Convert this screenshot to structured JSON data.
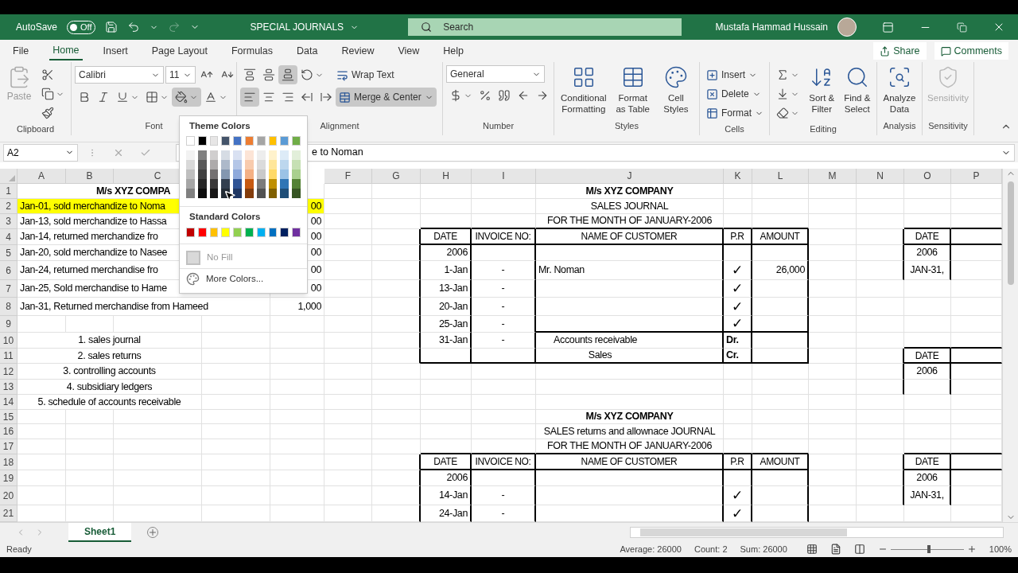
{
  "title_bar": {
    "autosave_label": "AutoSave",
    "autosave": {
      "on": false,
      "label": "Off"
    },
    "document": "SPECIAL JOURNALS",
    "search": {
      "placeholder": "Search"
    },
    "user": "Mustafa Hammad Hussain"
  },
  "menu_tabs": [
    {
      "label": "File",
      "selected": false
    },
    {
      "label": "Home",
      "selected": true
    },
    {
      "label": "Insert",
      "selected": false
    },
    {
      "label": "Page Layout",
      "selected": false
    },
    {
      "label": "Formulas",
      "selected": false
    },
    {
      "label": "Data",
      "selected": false
    },
    {
      "label": "Review",
      "selected": false
    },
    {
      "label": "View",
      "selected": false
    },
    {
      "label": "Help",
      "selected": false
    }
  ],
  "share": "Share",
  "comments": "Comments",
  "ribbon": {
    "clipboard": {
      "label": "Clipboard",
      "paste": "Paste"
    },
    "font": {
      "label": "Font",
      "font_name": "Calibri",
      "font_size": "11",
      "fill_menu_open": true
    },
    "alignment": {
      "label": "Alignment",
      "wrap_text": "Wrap Text",
      "merge": "Merge & Center"
    },
    "number": {
      "label": "Number",
      "format": "General"
    },
    "styles": {
      "label": "Styles",
      "buttons": [
        "Conditional Formatting",
        "Format as Table",
        "Cell Styles"
      ]
    },
    "cells": {
      "label": "Cells",
      "buttons": [
        "Insert",
        "Delete",
        "Format"
      ]
    },
    "editing": {
      "label": "Editing",
      "buttons": [
        "Sort & Filter",
        "Find & Select"
      ]
    },
    "analysis": {
      "label": "Analysis",
      "button": "Analyze Data"
    },
    "sensitivity": {
      "label": "Sensitivity",
      "button": "Sensitivity",
      "disabled": true
    }
  },
  "fill_menu": {
    "theme_title": "Theme Colors",
    "theme": [
      {
        "color": "#ffffff"
      },
      {
        "color": "#000000"
      },
      {
        "color": "#e7e6e6"
      },
      {
        "color": "#44546a"
      },
      {
        "color": "#4472c4"
      },
      {
        "color": "#ed7d31"
      },
      {
        "color": "#a5a5a5"
      },
      {
        "color": "#ffc000"
      },
      {
        "color": "#5b9bd5"
      },
      {
        "color": "#70ad47"
      }
    ],
    "shades": [
      [
        {
          "color": "#f2f2f2"
        },
        {
          "color": "#808080"
        },
        {
          "color": "#d0cece"
        },
        {
          "color": "#d6dce4"
        },
        {
          "color": "#d9e1f2"
        },
        {
          "color": "#fce4d6"
        },
        {
          "color": "#ededed"
        },
        {
          "color": "#fff2cc"
        },
        {
          "color": "#ddebf7"
        },
        {
          "color": "#e2efda"
        }
      ],
      [
        {
          "color": "#d9d9d9"
        },
        {
          "color": "#595959"
        },
        {
          "color": "#aeabab"
        },
        {
          "color": "#adb9ca"
        },
        {
          "color": "#b4c6e7"
        },
        {
          "color": "#f8cbad"
        },
        {
          "color": "#dbdbdb"
        },
        {
          "color": "#ffe699"
        },
        {
          "color": "#bdd7ee"
        },
        {
          "color": "#c6e0b4"
        }
      ],
      [
        {
          "color": "#bfbfbf"
        },
        {
          "color": "#404040"
        },
        {
          "color": "#757171"
        },
        {
          "color": "#8497b0"
        },
        {
          "color": "#8ea9db"
        },
        {
          "color": "#f4b084"
        },
        {
          "color": "#c9c9c9"
        },
        {
          "color": "#ffd966"
        },
        {
          "color": "#9bc2e6"
        },
        {
          "color": "#a9d08e"
        }
      ],
      [
        {
          "color": "#a6a6a6"
        },
        {
          "color": "#262626"
        },
        {
          "color": "#3a3838"
        },
        {
          "color": "#333f4f"
        },
        {
          "color": "#305496"
        },
        {
          "color": "#c65911"
        },
        {
          "color": "#7b7b7b"
        },
        {
          "color": "#bf8f00"
        },
        {
          "color": "#2f75b5"
        },
        {
          "color": "#548235"
        }
      ],
      [
        {
          "color": "#808080"
        },
        {
          "color": "#0d0d0d"
        },
        {
          "color": "#171616"
        },
        {
          "color": "#222b35"
        },
        {
          "color": "#203764"
        },
        {
          "color": "#833c0c"
        },
        {
          "color": "#525252"
        },
        {
          "color": "#806000"
        },
        {
          "color": "#1f4e78"
        },
        {
          "color": "#375623"
        }
      ]
    ],
    "standard_title": "Standard Colors",
    "standard": [
      {
        "color": "#c00000"
      },
      {
        "color": "#ff0000"
      },
      {
        "color": "#ffc000"
      },
      {
        "color": "#ffff00"
      },
      {
        "color": "#92d050"
      },
      {
        "color": "#00b050"
      },
      {
        "color": "#00b0f0"
      },
      {
        "color": "#0070c0"
      },
      {
        "color": "#002060"
      },
      {
        "color": "#7030a0"
      }
    ],
    "no_fill": "No Fill",
    "more_colors": "More Colors..."
  },
  "formula_bar": {
    "name_box": "A2",
    "content": "e to Noman"
  },
  "sheet": {
    "columns": [
      "A",
      "B",
      "C",
      null,
      null,
      "F",
      "G",
      "H",
      "I",
      "J",
      "K",
      "L",
      "M",
      "N",
      "O",
      "P"
    ],
    "rows": [
      {
        "number": "1",
        "cells": [
          {
            "kind": "cut-title",
            "text": "M/s XYZ  COMPA"
          },
          "",
          "",
          "",
          "",
          "",
          "",
          "",
          "",
          {
            "kind": "title",
            "text": "M/s XYZ COMPANY"
          }
        ]
      },
      {
        "number": "2",
        "cells": [
          {
            "kind": "text",
            "text": "Jan-01, sold merchandize to Noma",
            "color": "#ffff00"
          },
          "",
          "",
          "",
          {
            "kind": "num",
            "text": "00",
            "color": "#ffff00"
          },
          "",
          "",
          "",
          "",
          {
            "kind": "center",
            "text": "SALES JOURNAL"
          }
        ]
      },
      {
        "number": "3",
        "cells": [
          {
            "kind": "text",
            "text": "Jan-13, sold merchandize to Hassa"
          },
          "",
          "",
          "",
          {
            "kind": "num",
            "text": "00"
          },
          "",
          "",
          "",
          "",
          {
            "kind": "center",
            "text": "FOR THE MONTH OF JANUARY-2006"
          }
        ]
      },
      {
        "number": "4",
        "cells": [
          {
            "kind": "text",
            "text": "Jan-14, returned merchandize fro"
          },
          "",
          "",
          "",
          {
            "kind": "num",
            "text": "00"
          },
          "",
          "",
          {
            "kind": "header",
            "text": "DATE"
          },
          {
            "kind": "header",
            "text": "INVOICE NO:"
          },
          {
            "kind": "header",
            "text": "NAME OF CUSTOMER"
          },
          {
            "kind": "header",
            "text": "P.R"
          },
          {
            "kind": "header",
            "text": "AMOUNT"
          },
          "",
          "",
          {
            "kind": "header",
            "text": "DATE"
          }
        ]
      },
      {
        "number": "5",
        "cells": [
          {
            "kind": "text",
            "text": "Jan-20, sold merchandize to Nasee"
          },
          "",
          "",
          "",
          {
            "kind": "num",
            "text": "00"
          },
          "",
          "",
          {
            "kind": "num",
            "text": "2006"
          },
          "",
          "",
          "",
          "",
          "",
          "",
          {
            "kind": "center",
            "text": "2006"
          }
        ]
      },
      {
        "number": "6",
        "cells": [
          {
            "kind": "text",
            "text": "Jan-24, returned merchandise fro"
          },
          "",
          "",
          "",
          {
            "kind": "num",
            "text": "00"
          },
          "",
          "",
          {
            "kind": "num",
            "text": "1-Jan"
          },
          {
            "kind": "center",
            "text": "-"
          },
          {
            "kind": "text",
            "text": "Mr. Noman"
          },
          {
            "kind": "check",
            "text": "✓"
          },
          {
            "kind": "num",
            "text": "26,000"
          },
          "",
          "",
          {
            "kind": "center",
            "text": "JAN-31,"
          }
        ]
      },
      {
        "number": "7",
        "cells": [
          {
            "kind": "text",
            "text": "Jan-25, Sold merchandise to Hame"
          },
          "",
          "",
          "",
          {
            "kind": "num",
            "text": "00"
          },
          "",
          "",
          {
            "kind": "num",
            "text": "13-Jan"
          },
          {
            "kind": "center",
            "text": "-"
          },
          "",
          {
            "kind": "check",
            "text": "✓"
          }
        ]
      },
      {
        "number": "8",
        "cells": [
          {
            "kind": "text",
            "text": "Jan-31, Returned merchandise from Hameed"
          },
          "",
          "",
          "",
          {
            "kind": "num",
            "text": "1,000"
          },
          "",
          "",
          {
            "kind": "num",
            "text": "20-Jan"
          },
          {
            "kind": "center",
            "text": "-"
          },
          "",
          {
            "kind": "check",
            "text": "✓"
          }
        ]
      },
      {
        "number": "9",
        "cells": [
          "",
          "",
          "",
          "",
          "",
          "",
          "",
          {
            "kind": "num",
            "text": "25-Jan"
          },
          {
            "kind": "center",
            "text": "-"
          },
          "",
          {
            "kind": "check",
            "text": "✓"
          }
        ]
      },
      {
        "number": "10",
        "cells": [
          {
            "kind": "merged-center",
            "text": "1. sales journal"
          },
          "",
          "",
          "",
          "",
          "",
          "",
          {
            "kind": "num",
            "text": "31-Jan"
          },
          {
            "kind": "center",
            "text": "-"
          },
          {
            "kind": "indent",
            "text": "Accounts receivable"
          },
          {
            "kind": "label",
            "text": "Dr."
          }
        ]
      },
      {
        "number": "11",
        "cells": [
          {
            "kind": "merged-center",
            "text": "2. sales returns"
          },
          "",
          "",
          "",
          "",
          "",
          "",
          "",
          "",
          {
            "kind": "indent-center",
            "text": "Sales"
          },
          {
            "kind": "label",
            "text": "Cr."
          },
          "",
          "",
          "",
          {
            "kind": "header",
            "text": "DATE"
          }
        ]
      },
      {
        "number": "12",
        "cells": [
          {
            "kind": "merged-center",
            "text": "3. controlling accounts"
          },
          "",
          "",
          "",
          "",
          "",
          "",
          "",
          "",
          "",
          "",
          "",
          "",
          "",
          {
            "kind": "center",
            "text": "2006"
          }
        ]
      },
      {
        "number": "13",
        "cells": [
          {
            "kind": "merged-center",
            "text": "4. subsidiary ledgers"
          }
        ]
      },
      {
        "number": "14",
        "cells": [
          {
            "kind": "merged-center",
            "text": "5. schedule of accounts receivable"
          }
        ]
      },
      {
        "number": "15",
        "cells": [
          "",
          "",
          "",
          "",
          "",
          "",
          "",
          "",
          "",
          {
            "kind": "title",
            "text": "M/s XYZ COMPANY"
          }
        ]
      },
      {
        "number": "16",
        "cells": [
          "",
          "",
          "",
          "",
          "",
          "",
          "",
          "",
          "",
          {
            "kind": "center",
            "text": "SALES returns and allownace JOURNAL"
          }
        ]
      },
      {
        "number": "17",
        "cells": [
          "",
          "",
          "",
          "",
          "",
          "",
          "",
          "",
          "",
          {
            "kind": "center",
            "text": "FOR THE MONTH OF JANUARY-2006"
          }
        ]
      },
      {
        "number": "18",
        "cells": [
          "",
          "",
          "",
          "",
          "",
          "",
          "",
          {
            "kind": "header",
            "text": "DATE"
          },
          {
            "kind": "header",
            "text": "INVOICE NO:"
          },
          {
            "kind": "header",
            "text": "NAME OF CUSTOMER"
          },
          {
            "kind": "header",
            "text": "P.R"
          },
          {
            "kind": "header",
            "text": "AMOUNT"
          },
          "",
          "",
          {
            "kind": "header",
            "text": "DATE"
          }
        ]
      },
      {
        "number": "19",
        "cells": [
          "",
          "",
          "",
          "",
          "",
          "",
          "",
          {
            "kind": "num",
            "text": "2006"
          },
          "",
          "",
          "",
          "",
          "",
          "",
          {
            "kind": "center",
            "text": "2006"
          }
        ]
      },
      {
        "number": "20",
        "cells": [
          "",
          "",
          "",
          "",
          "",
          "",
          "",
          {
            "kind": "num",
            "text": "14-Jan"
          },
          {
            "kind": "center",
            "text": "-"
          },
          "",
          {
            "kind": "check",
            "text": "✓"
          },
          "",
          "",
          "",
          {
            "kind": "center",
            "text": "JAN-31,"
          }
        ]
      },
      {
        "number": "21",
        "cells": [
          "",
          "",
          "",
          "",
          "",
          "",
          "",
          {
            "kind": "num",
            "text": "24-Jan"
          },
          {
            "kind": "center",
            "text": "-"
          },
          "",
          {
            "kind": "check",
            "text": "✓"
          }
        ]
      }
    ]
  },
  "sheet_tabs": [
    {
      "label": "Sheet1",
      "selected": true
    }
  ],
  "status_bar": {
    "status": "Ready",
    "average": "Average: 26000",
    "count": "Count: 2",
    "sum": "Sum: 26000",
    "zoom": {
      "level": 0.5,
      "label": "100%"
    }
  }
}
